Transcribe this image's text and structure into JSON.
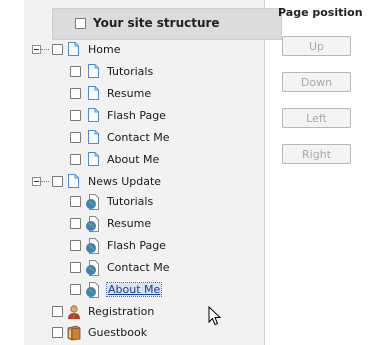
{
  "tree": {
    "header_label": "Your site structure",
    "groups": [
      {
        "label": "Home",
        "children": [
          {
            "label": "Tutorials",
            "icon": "page-icon"
          },
          {
            "label": "Resume",
            "icon": "page-icon"
          },
          {
            "label": "Flash Page",
            "icon": "page-icon"
          },
          {
            "label": "Contact Me",
            "icon": "page-icon"
          },
          {
            "label": "About Me",
            "icon": "page-icon"
          }
        ]
      },
      {
        "label": "News Update",
        "children": [
          {
            "label": "Tutorials",
            "icon": "globe-page-icon"
          },
          {
            "label": "Resume",
            "icon": "globe-page-icon"
          },
          {
            "label": "Flash Page",
            "icon": "globe-page-icon"
          },
          {
            "label": "Contact Me",
            "icon": "globe-page-icon"
          },
          {
            "label": "About Me",
            "icon": "globe-page-icon",
            "selected": true
          }
        ]
      }
    ],
    "standalone": [
      {
        "label": "Registration",
        "icon": "person-icon"
      },
      {
        "label": "Guestbook",
        "icon": "book-icon"
      }
    ]
  },
  "side": {
    "title": "Page position",
    "buttons": [
      "Up",
      "Down",
      "Left",
      "Right"
    ]
  },
  "colors": {
    "accent": "#3b6fb6",
    "page_icon": "#4a8fd6",
    "panel_bg": "#f2f2f2"
  }
}
